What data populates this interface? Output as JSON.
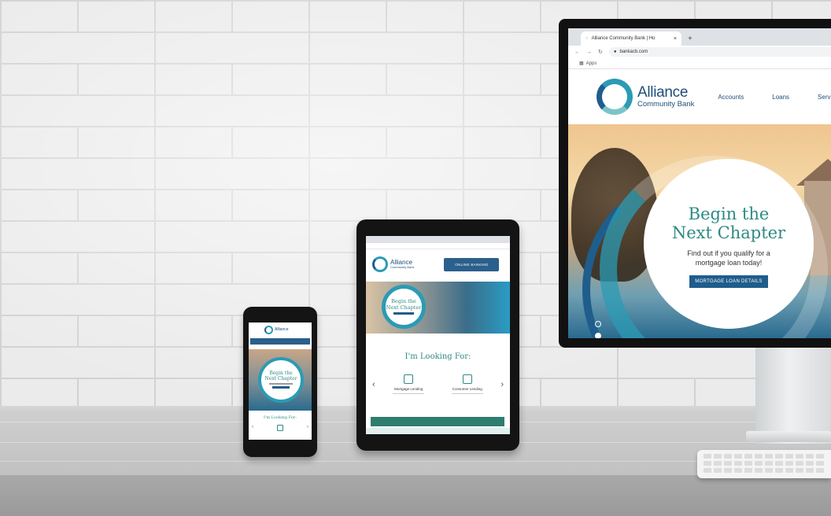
{
  "browser": {
    "tab_title": "Alliance Community Bank | Ho",
    "tab_close": "×",
    "new_tab": "+",
    "url": "bankacb.com",
    "bookmark_label": "Apps"
  },
  "site": {
    "logo_line1": "Alliance",
    "logo_line2": "Community Bank",
    "nav": [
      "Accounts",
      "Loans",
      "Servic"
    ],
    "hero_title_line1": "Begin the",
    "hero_title_line2": "Next Chapter",
    "hero_sub_line1": "Find out if you qualify for a",
    "hero_sub_line2": "mortgage loan today!",
    "hero_button": "MORTGAGE LOAN DETAILS"
  },
  "tablet": {
    "logo_line1": "Alliance",
    "logo_line2": "Community Bank",
    "online_button": "ONLINE BANKING",
    "hero_title_line1": "Begin the",
    "hero_title_line2": "Next Chapter",
    "looking_for": "I'm Looking For:",
    "cards": [
      {
        "label": "Mortgage Lending"
      },
      {
        "label": "Consumer Lending"
      }
    ],
    "arrow_left": "‹",
    "arrow_right": "›"
  },
  "phone": {
    "logo_text": "Alliance",
    "hero_title_line1": "Begin the",
    "hero_title_line2": "Next Chapter",
    "looking_for": "I'm Looking For:"
  },
  "colors": {
    "brand_blue": "#1f5d8c",
    "brand_teal": "#2b9bb4",
    "heading_green": "#2e8a84"
  }
}
